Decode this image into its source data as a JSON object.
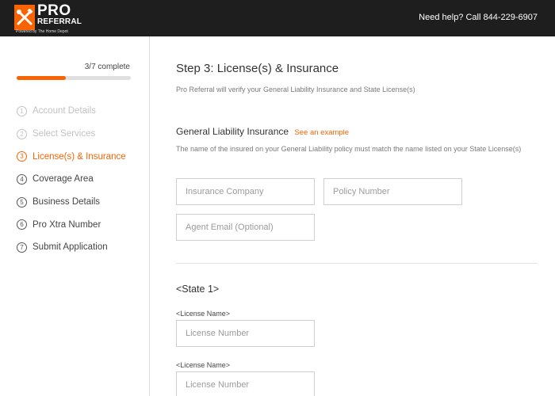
{
  "header": {
    "logo_pro": "PRO",
    "logo_referral": "REFERRAL",
    "logo_powered": "Powered by The Home Depot",
    "help_text": "Need help? Call 844-229-6907",
    "brand_color": "#f96302"
  },
  "sidebar": {
    "progress_text": "3/7 complete",
    "progress_fraction": 0.43,
    "steps": [
      {
        "num": "1",
        "label": "Account Details",
        "state": "done"
      },
      {
        "num": "2",
        "label": "Select Services",
        "state": "done"
      },
      {
        "num": "3",
        "label": "License(s) & Insurance",
        "state": "active"
      },
      {
        "num": "4",
        "label": "Coverage Area",
        "state": "pending"
      },
      {
        "num": "5",
        "label": "Business Details",
        "state": "pending"
      },
      {
        "num": "6",
        "label": "Pro Xtra Number",
        "state": "pending"
      },
      {
        "num": "7",
        "label": "Submit Application",
        "state": "pending"
      }
    ]
  },
  "main": {
    "title": "Step 3: License(s) & Insurance",
    "subtitle": "Pro Referral will verify your General Liability Insurance and State License(s)",
    "gl": {
      "heading": "General Liability Insurance",
      "example_link": "See an example",
      "description": "The name of the insured on your General Liability policy must match the name listed on your State License(s)",
      "insurance_company_placeholder": "Insurance Company",
      "policy_number_placeholder": "Policy Number",
      "agent_email_placeholder": "Agent Email (Optional)"
    },
    "state": {
      "heading": "<State 1>",
      "license_1_label": "<License Name>",
      "license_1_placeholder": "License Number",
      "license_2_label": "<License Name>",
      "license_2_placeholder": "License Number"
    }
  }
}
